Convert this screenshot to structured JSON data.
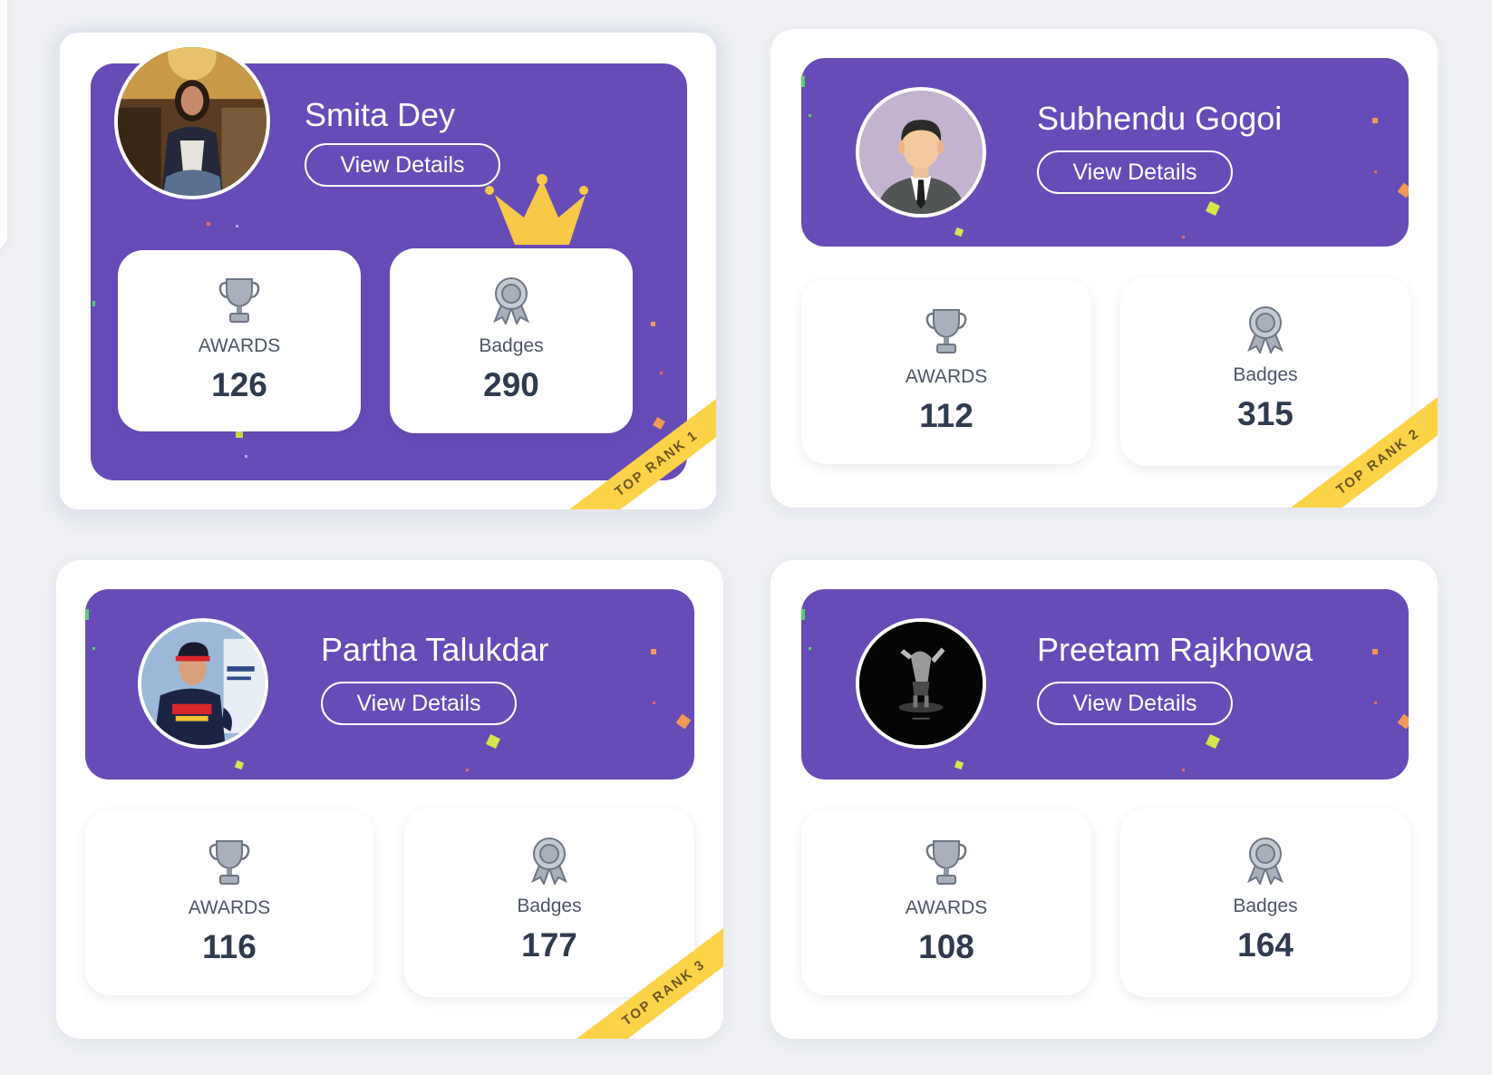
{
  "colors": {
    "page_bg": "#eef0f4",
    "banner_purple": "#674cb8",
    "ribbon_yellow": "#fbd348",
    "crown_yellow": "#f7c948",
    "text_dark": "#2f3a4d",
    "text_label": "#4c5566"
  },
  "cards": [
    {
      "name": "Smita Dey",
      "view_label": "View Details",
      "avatar_icon": "profile-photo-woman",
      "awards_label": "AWARDS",
      "awards_value": "126",
      "badges_label": "Badges",
      "badges_value": "290",
      "rank_label": "TOP RANK 1",
      "crown_icon": "crown-icon"
    },
    {
      "name": "Subhendu Gogoi",
      "view_label": "View Details",
      "avatar_icon": "default-avatar-man",
      "awards_label": "AWARDS",
      "awards_value": "112",
      "badges_label": "Badges",
      "badges_value": "315",
      "rank_label": "TOP RANK 2"
    },
    {
      "name": "Partha Talukdar",
      "view_label": "View Details",
      "avatar_icon": "profile-photo-racer",
      "awards_label": "AWARDS",
      "awards_value": "116",
      "badges_label": "Badges",
      "badges_value": "177",
      "rank_label": "TOP RANK 3"
    },
    {
      "name": "Preetam Rajkhowa",
      "view_label": "View Details",
      "avatar_icon": "profile-photo-dark",
      "awards_label": "AWARDS",
      "awards_value": "108",
      "badges_label": "Badges",
      "badges_value": "164"
    }
  ],
  "icons": {
    "awards": "trophy-icon",
    "badges": "badge-ribbon-icon"
  }
}
